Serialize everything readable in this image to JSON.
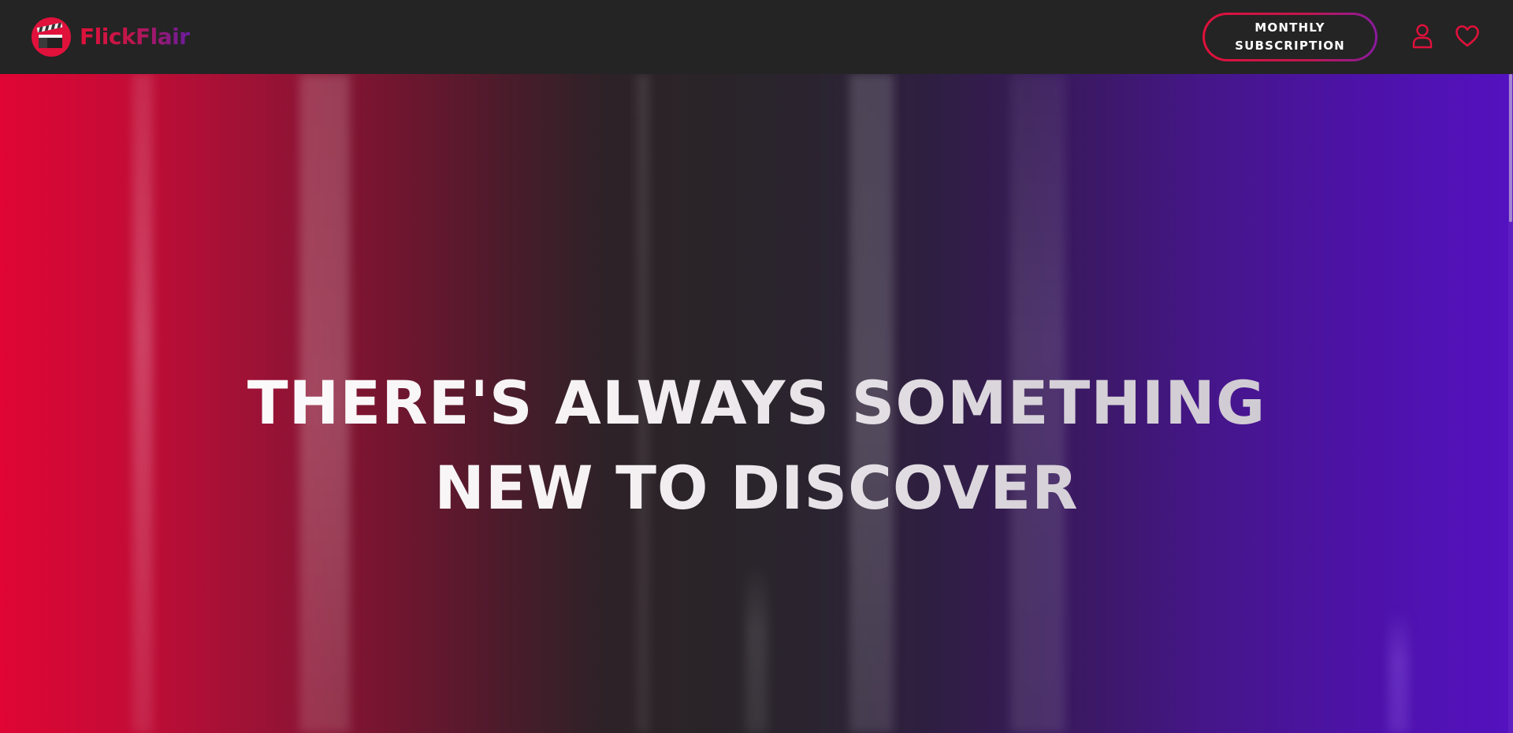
{
  "header": {
    "brand_name": "FlickFlair",
    "logo_icon": "clapperboard-icon",
    "subscription_button_label": "MONTHLY SUBSCRIPTION",
    "account_icon": "user-icon",
    "favorites_icon": "heart-icon"
  },
  "hero": {
    "title_line_1": "THERE'S ALWAYS SOMETHING",
    "title_line_2": "NEW TO DISCOVER"
  },
  "colors": {
    "brand_red": "#e0113b",
    "brand_purple": "#5411c0",
    "header_bg": "#242424"
  }
}
